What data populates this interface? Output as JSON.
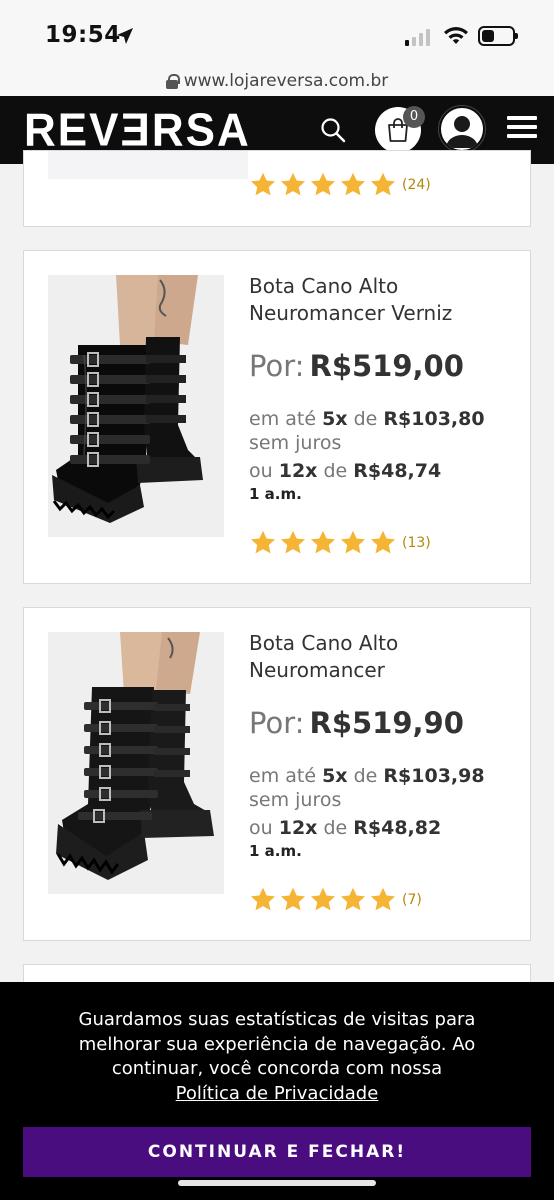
{
  "status": {
    "time": "19:54"
  },
  "browser": {
    "url": "www.lojareversa.com.br"
  },
  "header": {
    "logo": "REVƎRSA",
    "cart_count": "0"
  },
  "top_card": {
    "rating_count": "(24)"
  },
  "products": [
    {
      "name": "Bota Cano Alto Neuromancer Verniz",
      "price_label": "Por:",
      "price": "R$519,00",
      "inst_prefix": "em até",
      "inst_times": "5x",
      "inst_de": "de",
      "inst_value": "R$103,80",
      "inst_suffix": "sem juros",
      "alt_prefix": "ou",
      "alt_times": "12x",
      "alt_de": "de",
      "alt_value": "R$48,74",
      "alt_note": "1 a.m.",
      "rating_count": "(13)"
    },
    {
      "name": "Bota Cano Alto Neuromancer",
      "price_label": "Por:",
      "price": "R$519,90",
      "inst_prefix": "em até",
      "inst_times": "5x",
      "inst_de": "de",
      "inst_value": "R$103,98",
      "inst_suffix": "sem juros",
      "alt_prefix": "ou",
      "alt_times": "12x",
      "alt_de": "de",
      "alt_value": "R$48,82",
      "alt_note": "1 a.m.",
      "rating_count": "(7)"
    }
  ],
  "cookie": {
    "text": "Guardamos suas estatísticas de visitas para melhorar sua experiência de navegação. Ao continuar, você concorda com nossa",
    "link": "Política de Privacidade",
    "button": "CONTINUAR E FECHAR!"
  },
  "colors": {
    "accent": "#4a0d80",
    "star": "#f5b433",
    "header": "#0d0d0d"
  }
}
